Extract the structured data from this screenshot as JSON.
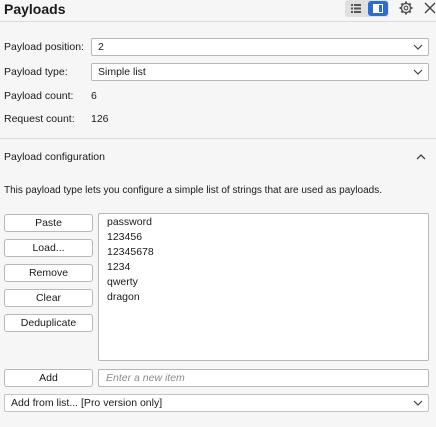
{
  "header": {
    "title": "Payloads",
    "icons": [
      "list-view-icon",
      "panel-view-icon",
      "gear-icon",
      "close-icon"
    ]
  },
  "payload_settings": {
    "position_label": "Payload position:",
    "position_value": "2",
    "type_label": "Payload type:",
    "type_value": "Simple list",
    "count_label": "Payload count:",
    "count_value": "6",
    "request_label": "Request count:",
    "request_value": "126"
  },
  "config": {
    "section_title": "Payload configuration",
    "description": "This payload type lets you configure a simple list of strings that are used as payloads.",
    "buttons": {
      "paste": "Paste",
      "load": "Load...",
      "remove": "Remove",
      "clear": "Clear",
      "deduplicate": "Deduplicate",
      "add": "Add"
    },
    "items": [
      "password",
      "123456",
      "12345678",
      "1234",
      "qwerty",
      "dragon"
    ],
    "add_placeholder": "Enter a new item",
    "add_from_list": "Add from list... [Pro version only]"
  },
  "colors": {
    "accent": "#2f6dc9",
    "background": "#f6f6f6"
  }
}
